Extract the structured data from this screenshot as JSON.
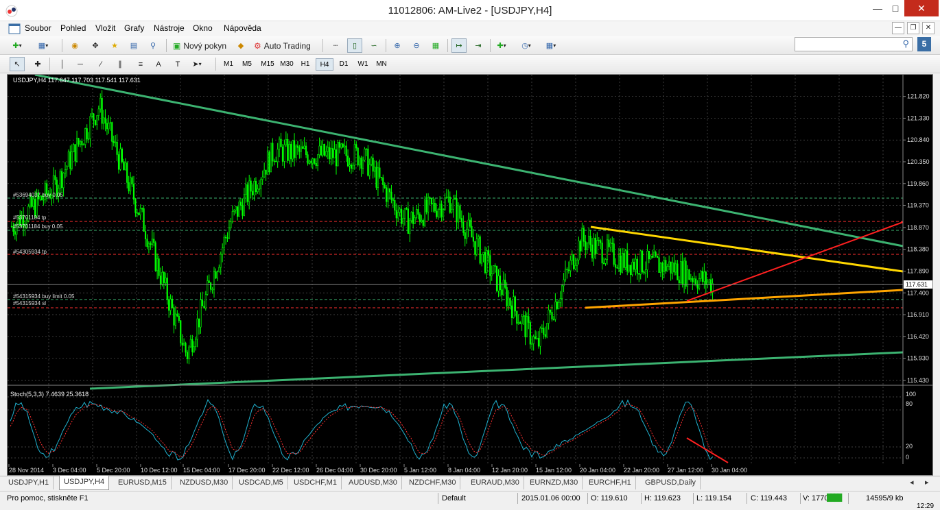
{
  "window": {
    "title": "11012806: AM-Live2 - [USDJPY,H4]",
    "icon": "app-icon"
  },
  "menu": [
    "Soubor",
    "Pohled",
    "Vložit",
    "Grafy",
    "Nástroje",
    "Okno",
    "Nápověda"
  ],
  "toolbar": {
    "new_order_label": "Nový pokyn",
    "auto_trading_label": "Auto Trading",
    "notification_count": "5"
  },
  "timeframes": [
    "M1",
    "M5",
    "M15",
    "M30",
    "H1",
    "H4",
    "D1",
    "W1",
    "MN"
  ],
  "active_timeframe": "H4",
  "chart": {
    "header": "USDJPY,H4  117.647 117.703 117.541 117.631",
    "price_axis": [
      "121.820",
      "121.330",
      "120.840",
      "120.350",
      "119.860",
      "119.370",
      "118.870",
      "118.380",
      "117.890",
      "117.400",
      "116.910",
      "116.420",
      "115.930",
      "115.430"
    ],
    "current_price": "117.631",
    "order_labels": [
      "#53694037 buy 0.05",
      "#53701184 tp",
      "#53701184 buy 0.05",
      "#54305934 tp",
      "#54315934 buy limit 0.05",
      "#54315934 sl"
    ],
    "date_axis": [
      "28 Nov 2014",
      "3 Dec 04:00",
      "5 Dec 20:00",
      "10 Dec 12:00",
      "15 Dec 04:00",
      "17 Dec 20:00",
      "22 Dec 12:00",
      "26 Dec 04:00",
      "30 Dec 20:00",
      "5 Jan 12:00",
      "8 Jan 04:00",
      "12 Jan 20:00",
      "15 Jan 12:00",
      "20 Jan 04:00",
      "22 Jan 20:00",
      "27 Jan 12:00",
      "30 Jan 04:00"
    ]
  },
  "indicator": {
    "header": "Stoch(5,3,3) 7.4639 25.3618",
    "axis": [
      "100",
      "80",
      "20",
      "0"
    ]
  },
  "tabs": [
    "USDJPY,H1",
    "USDJPY,H4",
    "EURUSD,M15",
    "NZDUSD,M30",
    "USDCAD,M5",
    "USDCHF,M1",
    "AUDUSD,M30",
    "NZDCHF,M30",
    "EURAUD,M30",
    "EURNZD,M30",
    "EURCHF,H1",
    "GBPUSD,Daily"
  ],
  "active_tab": "USDJPY,H4",
  "status": {
    "help": "Pro pomoc, stiskněte F1",
    "profile": "Default",
    "datetime": "2015.01.06 00:00",
    "open": "O: 119.610",
    "high": "H: 119.623",
    "low": "L: 119.154",
    "close": "C: 119.443",
    "volume": "V: 17704",
    "traffic": "14595/9 kb",
    "clock": "12:29"
  },
  "colors": {
    "candle": "#00ff00",
    "trend_main": "#3cb371",
    "trend_upper": "#ffd700",
    "trend_lower": "#ffa500",
    "trend_red": "#ff2020",
    "stoch_main": "#20b2d0",
    "stoch_signal": "#ff3030"
  },
  "chart_data": {
    "type": "line",
    "title": "USDJPY,H4",
    "x": [
      "28 Nov",
      "3 Dec",
      "5 Dec",
      "10 Dec",
      "15 Dec",
      "17 Dec",
      "22 Dec",
      "26 Dec",
      "30 Dec",
      "5 Jan",
      "8 Jan",
      "12 Jan",
      "15 Jan",
      "20 Jan",
      "22 Jan",
      "27 Jan",
      "30 Jan"
    ],
    "series": [
      {
        "values": [
          118.9,
          119.8,
          121.6,
          119.0,
          116.0,
          119.0,
          120.6,
          120.5,
          120.5,
          119.0,
          119.5,
          117.8,
          116.2,
          118.6,
          118.1,
          118.0,
          117.6
        ]
      }
    ],
    "ylim": [
      115.43,
      122.0
    ]
  }
}
